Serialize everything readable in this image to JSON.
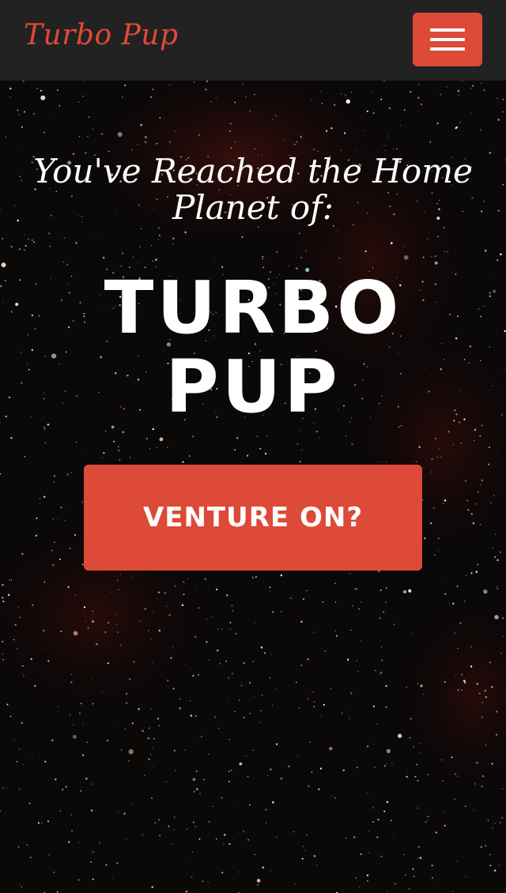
{
  "navbar": {
    "brand": "Turbo Pup",
    "menu_icon": "hamburger-menu-icon",
    "accent_color": "#dd4a37",
    "background_color": "#222222"
  },
  "hero": {
    "intro": "You've Reached the Home Planet of:",
    "headline_line1": "TURBO",
    "headline_line2": "PUP",
    "cta_label": "VENTURE ON?",
    "background": "starfield"
  }
}
